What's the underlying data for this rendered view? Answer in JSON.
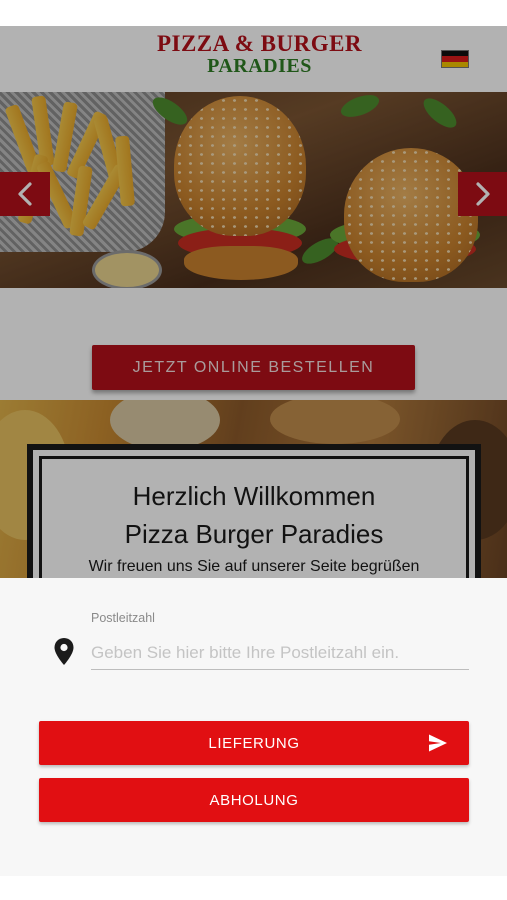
{
  "site": {
    "logo": {
      "line1": "PIZZA & BURGER",
      "line2": "PARADIES"
    },
    "language_flag": "german-flag",
    "slider": {
      "prev_icon": "chevron-left-icon",
      "next_icon": "chevron-right-icon"
    },
    "cta_label": "JETZT ONLINE BESTELLEN",
    "welcome": {
      "title_line1": "Herzlich Willkommen",
      "title_line2": "Pizza Burger Paradies",
      "subtitle": "Wir freuen uns Sie auf unserer Seite begrüßen"
    }
  },
  "sheet": {
    "postcode_label": "Postleitzahl",
    "postcode_placeholder": "Geben Sie hier bitte Ihre Postleitzahl ein.",
    "postcode_value": "",
    "location_icon": "map-pin-icon",
    "delivery_label": "LIEFERUNG",
    "delivery_icon": "send-icon",
    "pickup_label": "ABHOLUNG"
  },
  "colors": {
    "brand_red": "#b3101a",
    "button_red": "#e10f12",
    "logo_green": "#2f7d25"
  }
}
